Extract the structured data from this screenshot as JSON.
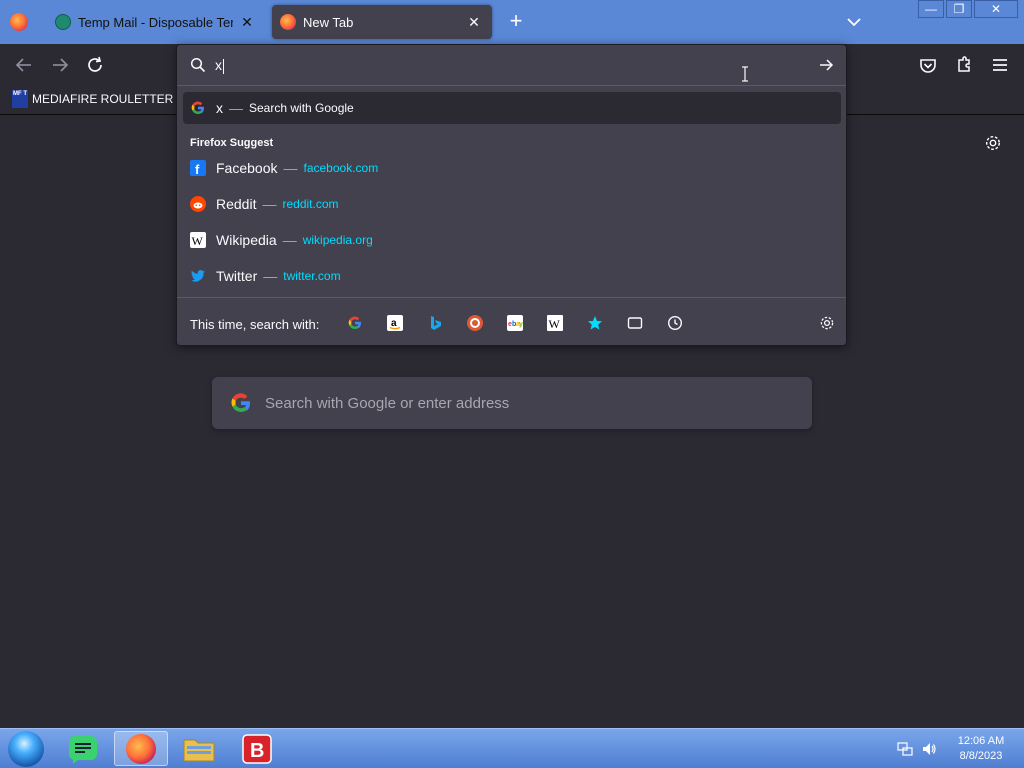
{
  "tabs": [
    {
      "title": "Temp Mail - Disposable Temporary Email",
      "close": "✕"
    },
    {
      "title": "New Tab",
      "close": "✕"
    }
  ],
  "new_tab_label": "+",
  "window_controls": {
    "minimize": "—",
    "maximize": "❐",
    "close": "✕"
  },
  "bookmarks": [
    {
      "label": "MEDIAFIRE ROULETTER",
      "icon_text": "MF T"
    }
  ],
  "urlbar": {
    "typed": "x",
    "suggestions": [
      {
        "title": "x",
        "action": "Search with Google",
        "icon": "google-icon"
      }
    ],
    "group_label": "Firefox Suggest",
    "sites": [
      {
        "title": "Facebook",
        "url": "facebook.com",
        "icon": "facebook-icon"
      },
      {
        "title": "Reddit",
        "url": "reddit.com",
        "icon": "reddit-icon"
      },
      {
        "title": "Wikipedia",
        "url": "wikipedia.org",
        "icon": "wikipedia-icon"
      },
      {
        "title": "Twitter",
        "url": "twitter.com",
        "icon": "twitter-icon"
      }
    ],
    "oneoff_label": "This time, search with:",
    "engines": [
      "google",
      "amazon",
      "bing",
      "duckduckgo",
      "ebay",
      "wikipedia",
      "bookmarks",
      "tabs",
      "history"
    ]
  },
  "main_search_placeholder": "Search with Google or enter address",
  "taskbar": {
    "time": "12:06 AM",
    "date": "8/8/2023"
  },
  "colors": {
    "tabstrip": "#5a87d6",
    "toolbar": "#2b2a33",
    "popup": "#42414d",
    "link": "#00ddff"
  }
}
